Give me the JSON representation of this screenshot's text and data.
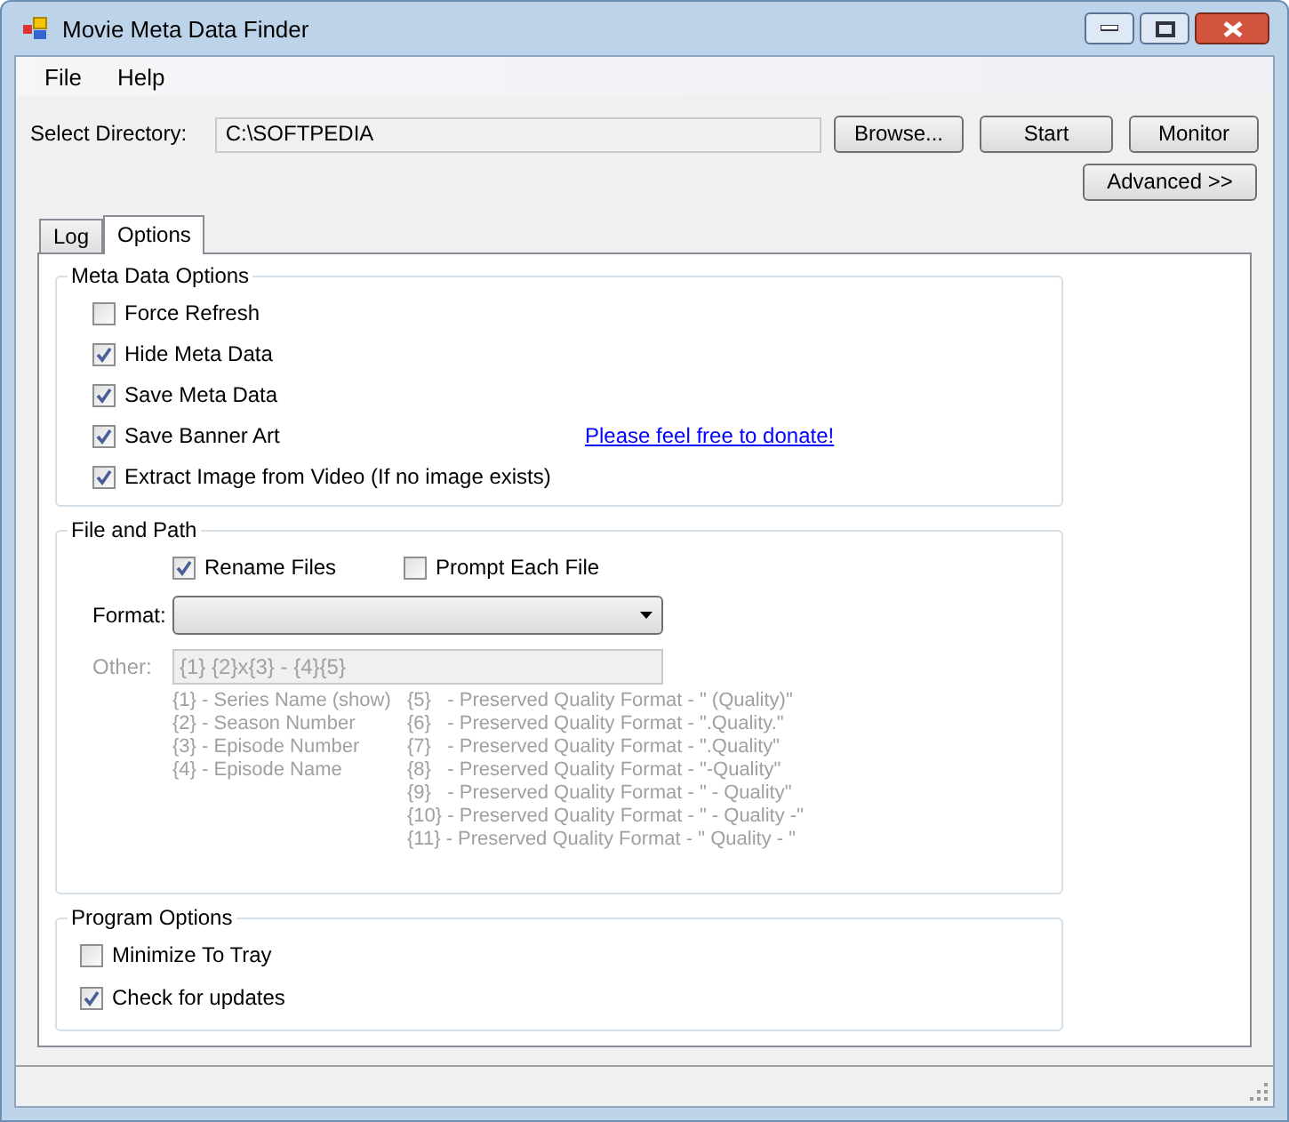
{
  "window": {
    "title": "Movie Meta Data Finder"
  },
  "menu": [
    "File",
    "Help"
  ],
  "directory": {
    "label": "Select Directory:",
    "value": "C:\\SOFTPEDIA"
  },
  "buttons": [
    "Browse...",
    "Start",
    "Monitor"
  ],
  "advanced_button": "Advanced >>",
  "tabs": [
    {
      "label": "Log",
      "selected": false
    },
    {
      "label": "Options",
      "selected": true
    }
  ],
  "meta_data_options": {
    "title": "Meta Data Options",
    "checkboxes": [
      {
        "label": "Force Refresh",
        "checked": false
      },
      {
        "label": "Hide Meta Data",
        "checked": true
      },
      {
        "label": "Save Meta Data",
        "checked": true
      },
      {
        "label": "Save Banner Art",
        "checked": true
      },
      {
        "label": "Extract Image from Video (If no image exists)",
        "checked": true
      }
    ],
    "donate_link": "Please feel free to donate!"
  },
  "file_and_path": {
    "title": "File and Path",
    "checkboxes": [
      {
        "label": "Rename Files",
        "checked": true
      },
      {
        "label": "Prompt Each File",
        "checked": false
      }
    ],
    "format": {
      "label": "Format:"
    },
    "other": {
      "label": "Other:",
      "value": "{1} {2}x{3} - {4}{5}",
      "disabled": true
    },
    "legend_column_1": [
      "{1} - Series Name (show)",
      "{2} - Season Number",
      "{3} - Episode Number",
      "{4} - Episode Name"
    ],
    "legend_column_2": [
      "{5}   - Preserved Quality Format - \" (Quality)\"",
      "{6}   - Preserved Quality Format - \".Quality.\"",
      "{7}   - Preserved Quality Format - \".Quality\"",
      "{8}   - Preserved Quality Format - \"-Quality\"",
      "{9}   - Preserved Quality Format - \" - Quality\"",
      "{10} - Preserved Quality Format - \" - Quality -\"",
      "{11} - Preserved Quality Format - \" Quality - \""
    ]
  },
  "program_options": {
    "title": "Program Options",
    "checkboxes": [
      {
        "label": "Minimize To Tray",
        "checked": false
      },
      {
        "label": "Check for updates",
        "checked": true
      }
    ]
  }
}
